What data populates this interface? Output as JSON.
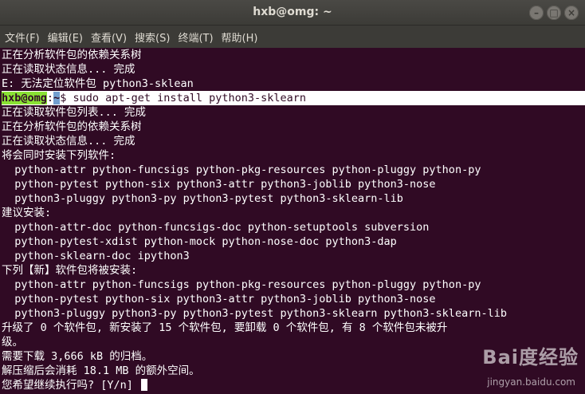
{
  "window": {
    "title": "hxb@omg: ~",
    "buttons": [
      "–",
      "□",
      "×"
    ]
  },
  "menu": [
    "文件(F)",
    "编辑(E)",
    "查看(V)",
    "搜索(S)",
    "终端(T)",
    "帮助(H)"
  ],
  "prompt": {
    "user": "hxb@omg",
    "sep": ":",
    "path": "~",
    "command": "$ sudo apt-get install python3-sklearn"
  },
  "lines_before": [
    "正在分析软件包的依赖关系树",
    "正在读取状态信息... 完成",
    "E: 无法定位软件包 python3-sklean"
  ],
  "lines_after": [
    "正在读取软件包列表... 完成",
    "正在分析软件包的依赖关系树",
    "正在读取状态信息... 完成",
    "将会同时安装下列软件:",
    "  python-attr python-funcsigs python-pkg-resources python-pluggy python-py",
    "  python-pytest python-six python3-attr python3-joblib python3-nose",
    "  python3-pluggy python3-py python3-pytest python3-sklearn-lib",
    "建议安装:",
    "  python-attr-doc python-funcsigs-doc python-setuptools subversion",
    "  python-pytest-xdist python-mock python-nose-doc python3-dap",
    "  python-sklearn-doc ipython3",
    "下列【新】软件包将被安装:",
    "  python-attr python-funcsigs python-pkg-resources python-pluggy python-py",
    "  python-pytest python-six python3-attr python3-joblib python3-nose",
    "  python3-pluggy python3-py python3-pytest python3-sklearn python3-sklearn-lib",
    "升级了 0 个软件包, 新安装了 15 个软件包, 要卸载 0 个软件包, 有 8 个软件包未被升",
    "级。",
    "需要下载 3,666 kB 的归档。",
    "解压缩后会消耗 18.1 MB 的额外空间。",
    "您希望继续执行吗? [Y/n] "
  ],
  "watermark": {
    "logo": "Bai度经验",
    "sub": "jingyan.baidu.com"
  }
}
